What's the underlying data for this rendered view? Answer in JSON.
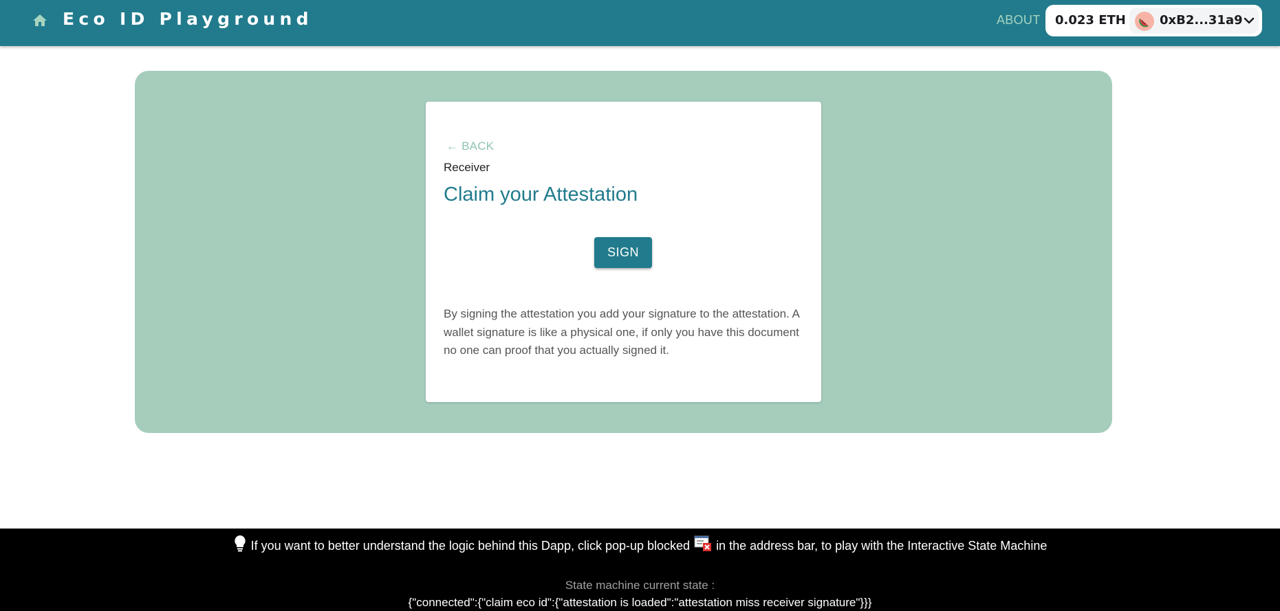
{
  "header": {
    "title": "Eco ID Playground",
    "home_icon": "home-icon",
    "about_label": "ABOUT",
    "wallet": {
      "balance": "0.023 ETH",
      "address": "0xB2...31a9",
      "avatar_icon": "watermelon-icon",
      "dropdown_icon": "chevron-down-icon"
    }
  },
  "card": {
    "back_label": "← BACK",
    "role_label": "Receiver",
    "title": "Claim your Attestation",
    "sign_label": "SIGN",
    "description": "By signing the attestation you add your signature to the attestation. A wallet signature is like a physical one, if only you have this document no one can proof that you actually signed it."
  },
  "footer": {
    "hint_before": "If you want to better understand the logic behind this Dapp, click pop-up blocked",
    "hint_after": "in the address bar, to play with the Interactive State Machine",
    "state_label": "State machine current state :",
    "state_value": "{\"connected\":{\"claim eco id\":{\"attestation is loaded\":\"attestation miss receiver signature\"}}}"
  },
  "colors": {
    "header_bg": "#217b8c",
    "panel_bg": "#a6cdbc",
    "accent": "#217b8c",
    "back_link": "#8fc4b0"
  }
}
